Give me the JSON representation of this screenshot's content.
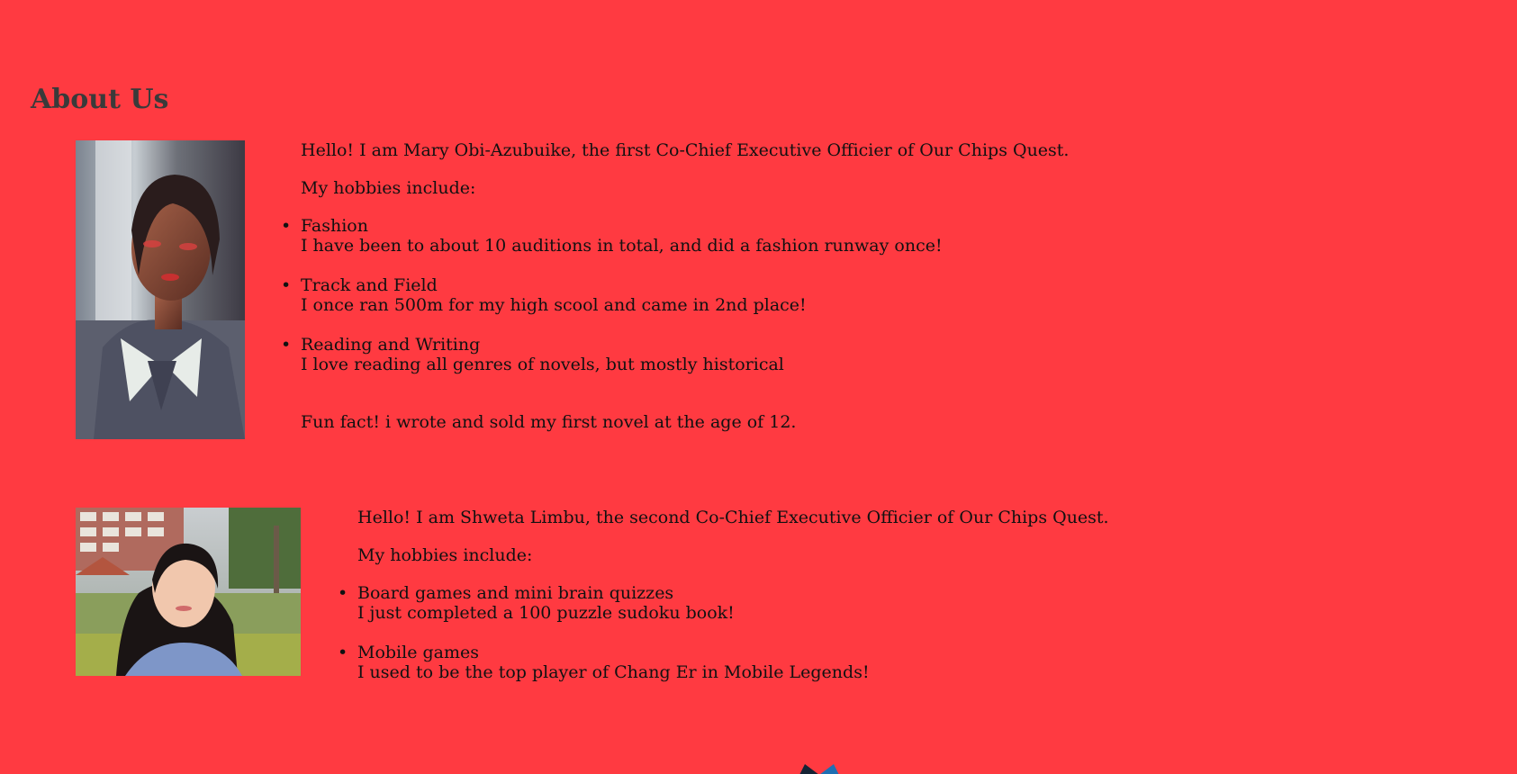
{
  "page": {
    "title": "About Us"
  },
  "members": [
    {
      "intro": "Hello! I am Mary Obi-Azubuike, the first Co-Chief Executive Officier of Our Chips Quest.",
      "hobbies_heading": "My hobbies include:",
      "hobbies": [
        {
          "name": "Fashion",
          "detail": "I have been to about 10 auditions in total, and did a fashion runway once!"
        },
        {
          "name": "Track and Field",
          "detail": "I once ran 500m for my high scool and came in 2nd place!"
        },
        {
          "name": "Reading and Writing",
          "detail": "I love reading all genres of novels, but mostly historical"
        }
      ],
      "fun_fact": "Fun fact! i wrote and sold my first novel at the age of 12."
    },
    {
      "intro": "Hello! I am Shweta Limbu, the second Co-Chief Executive Officier of Our Chips Quest.",
      "hobbies_heading": "My hobbies include:",
      "hobbies": [
        {
          "name": "Board games and mini brain quizzes",
          "detail": "I just completed a 100 puzzle sudoku book!"
        },
        {
          "name": "Mobile games",
          "detail": "I used to be the top player of Chang Er in Mobile Legends!"
        }
      ]
    }
  ],
  "colors": {
    "background": "#ff3a41",
    "title": "#3a3a3a",
    "text": "#111111"
  },
  "icons": {
    "bullet": "•"
  }
}
